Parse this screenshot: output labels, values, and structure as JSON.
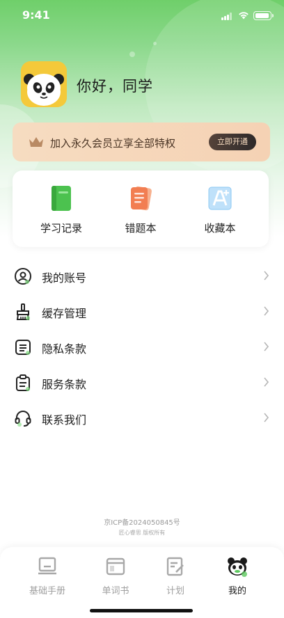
{
  "status_bar": {
    "time": "9:41"
  },
  "profile": {
    "greeting": "你好，同学",
    "avatar": "panda-avatar"
  },
  "vip_banner": {
    "text": "加入永久会员立享全部特权",
    "button": "立即开通",
    "icon": "crown-icon"
  },
  "features": [
    {
      "label": "学习记录",
      "icon": "green-book-icon"
    },
    {
      "label": "错题本",
      "icon": "orange-notebook-icon"
    },
    {
      "label": "收藏本",
      "icon": "a-plus-icon"
    }
  ],
  "menu": [
    {
      "label": "我的账号",
      "icon": "user-circle-icon"
    },
    {
      "label": "缓存管理",
      "icon": "broom-icon"
    },
    {
      "label": "隐私条款",
      "icon": "document-icon"
    },
    {
      "label": "服务条款",
      "icon": "clipboard-icon"
    },
    {
      "label": "联系我们",
      "icon": "headset-icon"
    }
  ],
  "footer": {
    "icp": "京ICP备2024050845号",
    "copyright": "匠心睿思 版权所有"
  },
  "tabbar": [
    {
      "label": "基础手册",
      "icon": "manual-icon",
      "active": false
    },
    {
      "label": "单词书",
      "icon": "wordbook-icon",
      "active": false
    },
    {
      "label": "计划",
      "icon": "plan-icon",
      "active": false
    },
    {
      "label": "我的",
      "icon": "panda-icon",
      "active": true
    }
  ],
  "colors": {
    "accent": "#5cc85e",
    "vip_bg": "#f6dcc1",
    "vip_button": "#3a302c"
  }
}
